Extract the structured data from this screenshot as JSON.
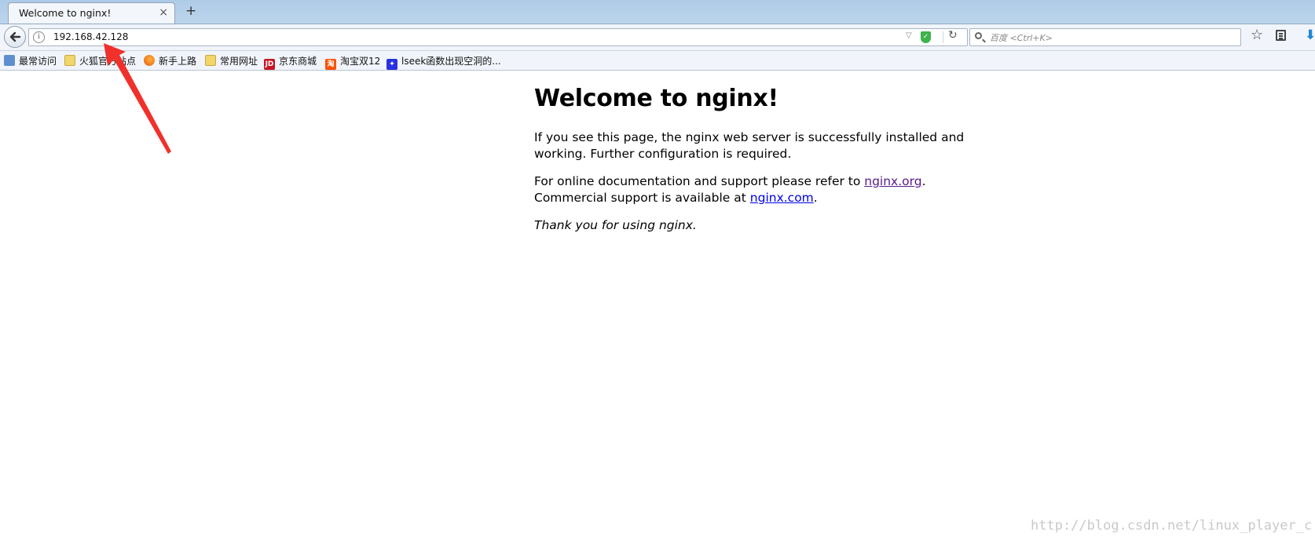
{
  "browser": {
    "tab_title": "Welcome to nginx!",
    "tab_close_glyph": "×",
    "new_tab_glyph": "+",
    "url": "192.168.42.128",
    "search_placeholder": "百度 <Ctrl+K>",
    "accent_color": "#1e88d6"
  },
  "bookmarks": [
    {
      "label": "最常访问",
      "icon": "recent-icon"
    },
    {
      "label": "火狐官方站点",
      "icon": "folder-icon"
    },
    {
      "label": "新手上路",
      "icon": "firefox-icon"
    },
    {
      "label": "常用网址",
      "icon": "folder-icon"
    },
    {
      "label": "京东商城",
      "icon": "jd-icon",
      "icon_text": "JD"
    },
    {
      "label": "淘宝双12",
      "icon": "taobao-icon",
      "icon_text": "淘"
    },
    {
      "label": "lseek函数出现空洞的...",
      "icon": "baidu-icon"
    }
  ],
  "page": {
    "heading": "Welcome to nginx!",
    "p1": "If you see this page, the nginx web server is successfully installed and working. Further configuration is required.",
    "p2_prefix": "For online documentation and support please refer to ",
    "link_org": "nginx.org",
    "p2_mid": ".",
    "p2_line2": "Commercial support is available at ",
    "link_com": "nginx.com",
    "p2_end": ".",
    "thanks": "Thank you for using nginx."
  },
  "annotation": {
    "arrow_color": "#f0302a"
  },
  "watermark": "http://blog.csdn.net/linux_player_c"
}
